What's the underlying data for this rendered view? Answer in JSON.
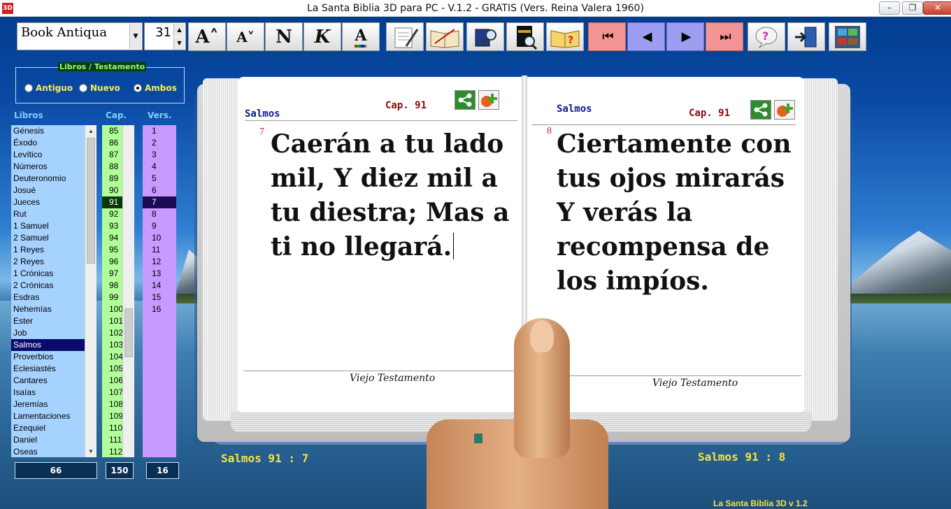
{
  "window": {
    "title": "La Santa Biblia 3D para PC - V.1.2 - GRATIS (Vers. Reina Valera 1960)",
    "app_icon": "3D",
    "minimize": "–",
    "maximize": "❐",
    "close": "✕"
  },
  "toolbar": {
    "font_name": "Book Antiqua",
    "font_size": "31",
    "increase_font": "A˄",
    "decrease_font": "A˅",
    "normal_font": "N",
    "italic_font": "K",
    "font_color": "A",
    "nav_first": "⏮",
    "nav_prev": "◀",
    "nav_next": "▶",
    "nav_last": "⏭",
    "icons": [
      "notes-icon",
      "open-book-icon",
      "bible-search-icon",
      "holy-bible-search-icon",
      "help-book-icon",
      "first-icon",
      "previous-icon",
      "next-icon",
      "last-icon",
      "question-icon",
      "exit-icon",
      "theme-icon"
    ]
  },
  "sidebar": {
    "group_legend": "Libros / Testamento",
    "radios": [
      {
        "label": "Antiguo",
        "checked": false
      },
      {
        "label": "Nuevo",
        "checked": false
      },
      {
        "label": "Ambos",
        "checked": true
      }
    ],
    "col_books": "Libros",
    "col_chapters": "Cap.",
    "col_verses": "Vers.",
    "books": [
      "Génesis",
      "Éxodo",
      "Levítico",
      "Números",
      "Deuteronomio",
      "Josué",
      "Jueces",
      "Rut",
      "1 Samuel",
      "2 Samuel",
      "1 Reyes",
      "2 Reyes",
      "1 Crónicas",
      "2 Crónicas",
      "Esdras",
      "Nehemías",
      "Ester",
      "Job",
      "Salmos",
      "Proverbios",
      "Eclesiastés",
      "Cantares",
      "Isaías",
      "Jeremías",
      "Lamentaciones",
      "Ezequiel",
      "Daniel",
      "Oseas"
    ],
    "selected_book": "Salmos",
    "chapters": [
      "85",
      "86",
      "87",
      "88",
      "89",
      "90",
      "91",
      "92",
      "93",
      "94",
      "95",
      "96",
      "97",
      "98",
      "99",
      "100",
      "101",
      "102",
      "103",
      "104",
      "105",
      "106",
      "107",
      "108",
      "109",
      "110",
      "111",
      "112"
    ],
    "selected_chapter": "91",
    "verses": [
      "1",
      "2",
      "3",
      "4",
      "5",
      "6",
      "7",
      "8",
      "9",
      "10",
      "11",
      "12",
      "13",
      "14",
      "15",
      "16"
    ],
    "selected_verse": "7",
    "count_books": "66",
    "count_chapters": "150",
    "count_verses": "16"
  },
  "book": {
    "left": {
      "book_name": "Salmos",
      "chapter": "Cap. 91",
      "verse_number": "7",
      "verse_text": "Caerán a tu lado mil, Y diez mil a tu diestra; Mas a ti no llegará.",
      "footer": "Viejo Testamento",
      "reference": "Salmos 91 : 7"
    },
    "right": {
      "book_name": "Salmos",
      "chapter": "Cap. 91",
      "verse_number": "8",
      "verse_text": "Ciertamente con tus ojos mirarás Y verás la recompensa de los impíos.",
      "footer": "Viejo Testamento",
      "reference": "Salmos 91 : 8"
    }
  },
  "status": {
    "version": "La Santa Biblia 3D v 1.2"
  },
  "colors": {
    "books_list": "#a6d2ff",
    "chapters_list": "#b0ff9a",
    "verses_list": "#c69aff",
    "nav_red": "#f29494",
    "nav_blue": "#9d9df2",
    "reference_yellow": "#f7e53a"
  }
}
